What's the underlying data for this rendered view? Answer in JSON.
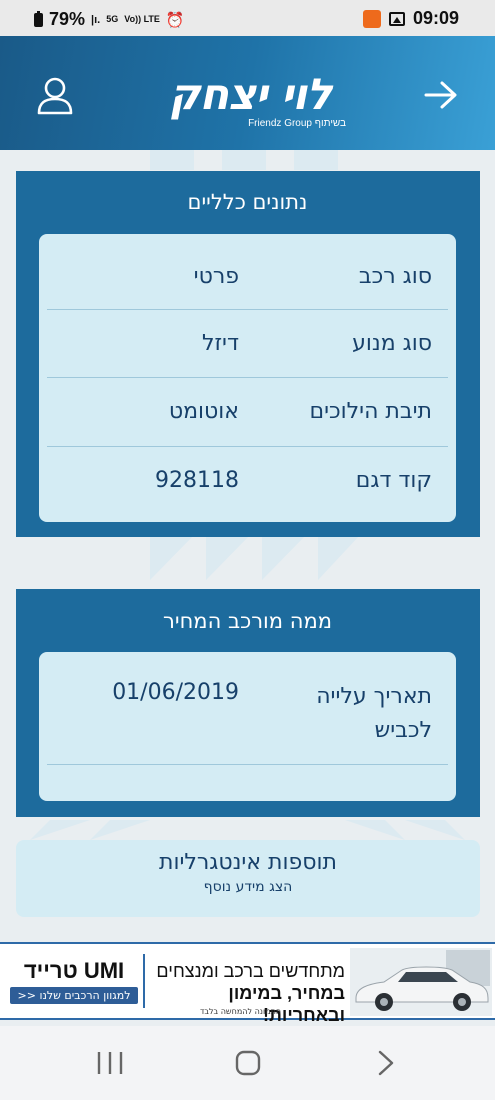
{
  "status_bar": {
    "battery": "79%",
    "network_5g": "5G",
    "volte": "Vo)) LTE",
    "time": "09:09",
    "icons": [
      "battery-icon",
      "signal-icon",
      "5g-icon",
      "volte-icon",
      "alarm-icon",
      "app-badge-icon",
      "gallery-icon"
    ]
  },
  "header": {
    "logo_text": "לוי יצחק",
    "logo_sub": "Friendz Group בשיתוף",
    "left_icon": "user-icon",
    "right_icon": "arrow-right-icon",
    "gradient": [
      "#1a5a88",
      "#3aa0d6"
    ]
  },
  "general_card": {
    "title": "נתונים כלליים",
    "rows": [
      {
        "label": "סוג רכב",
        "value": "פרטי"
      },
      {
        "label": "סוג מנוע",
        "value": "דיזל"
      },
      {
        "label": "תיבת הילוכים",
        "value": "אוטומט"
      },
      {
        "label": "קוד דגם",
        "value": "928118"
      }
    ]
  },
  "price_card": {
    "title": "ממה מורכב המחיר",
    "rows": [
      {
        "label": "תאריך עלייה לכביש",
        "value": "01/06/2019"
      }
    ]
  },
  "extras": {
    "title": "תוספות אינטגרליות",
    "link": "הצג מידע נוסף"
  },
  "ad": {
    "brand": "UMI טרייד",
    "cta": "למגוון הרכבים שלנו <<",
    "line1": "מתחדשים ברכב ומנצחים",
    "line2": "במחיר, במימון ובאחריות!",
    "note": "התמונה להמחשה בלבד"
  },
  "nav": {
    "buttons": [
      "recent-apps-icon",
      "home-icon",
      "back-icon"
    ]
  },
  "colors": {
    "card_blue": "#1d6b9d",
    "inner_bg": "#d4ecf4",
    "text_dark": "#17406a"
  }
}
